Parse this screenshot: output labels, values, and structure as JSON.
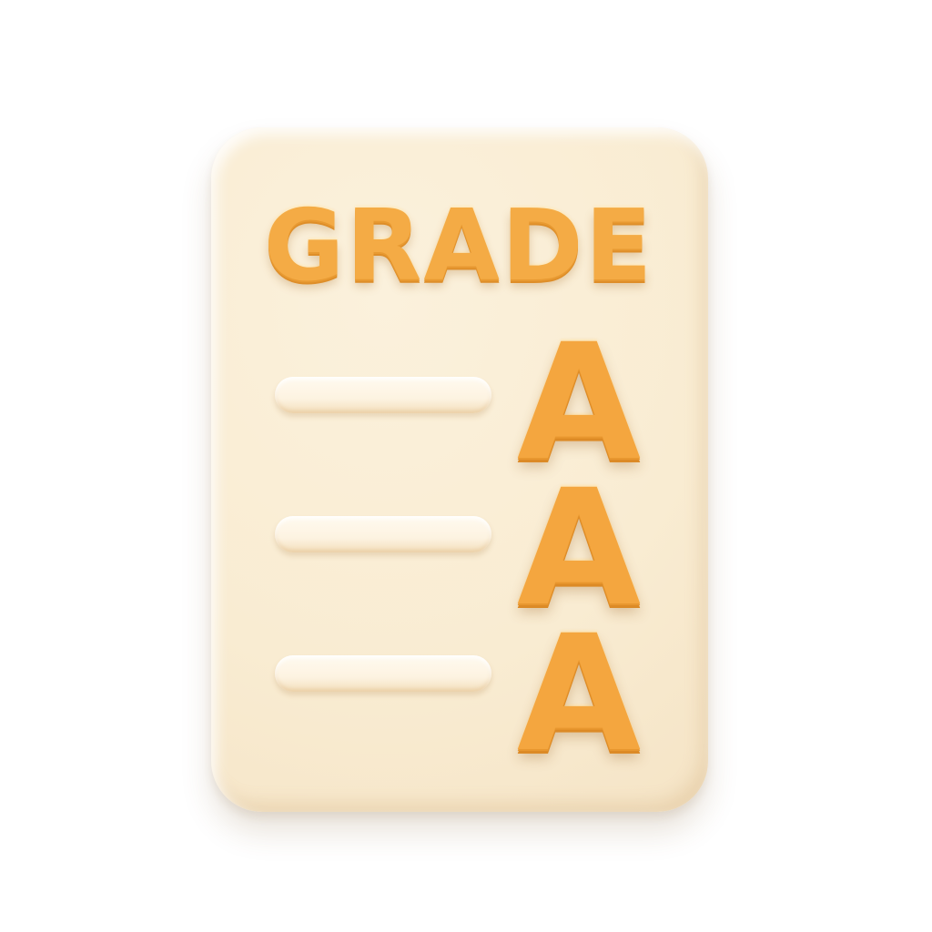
{
  "card": {
    "title": "GRADE",
    "rows": [
      {
        "grade": "A"
      },
      {
        "grade": "A"
      },
      {
        "grade": "A"
      }
    ]
  },
  "colors": {
    "card_face": "#f9ecd2",
    "letter_orange": "#f4a63f",
    "bar_cream": "#fdf3e1",
    "background": "#ffffff"
  }
}
